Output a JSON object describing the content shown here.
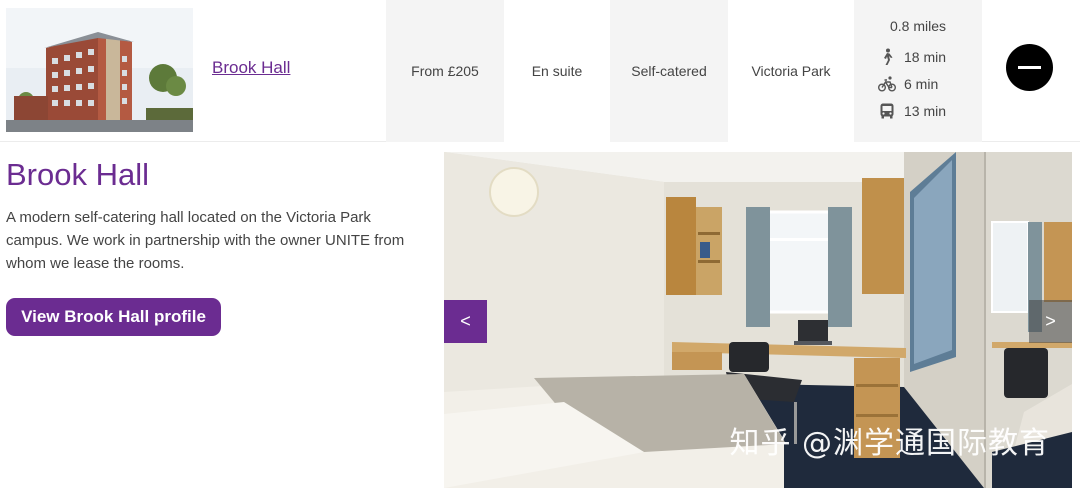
{
  "hall": {
    "name_link": "Brook Hall",
    "price": "From £205",
    "bathroom": "En suite",
    "catering": "Self-catered",
    "campus": "Victoria Park",
    "distance": "0.8 miles",
    "travel": [
      {
        "mode": "walk-icon",
        "time": "18 min"
      },
      {
        "mode": "bike-icon",
        "time": "6 min"
      },
      {
        "mode": "bus-icon",
        "time": "13 min"
      }
    ]
  },
  "detail": {
    "title": "Brook Hall",
    "description": "A modern self-catering hall located on the Victoria Park campus. We work in partnership with the owner UNITE from whom we lease the rooms.",
    "profile_button": "View Brook Hall profile"
  },
  "gallery": {
    "prev_label": "<",
    "next_label": ">",
    "watermark": "知乎 @渊学通国际教育"
  },
  "colors": {
    "accent": "#6b2c91",
    "cell_grey": "#f4f4f4",
    "collapse_button": "#000000"
  }
}
